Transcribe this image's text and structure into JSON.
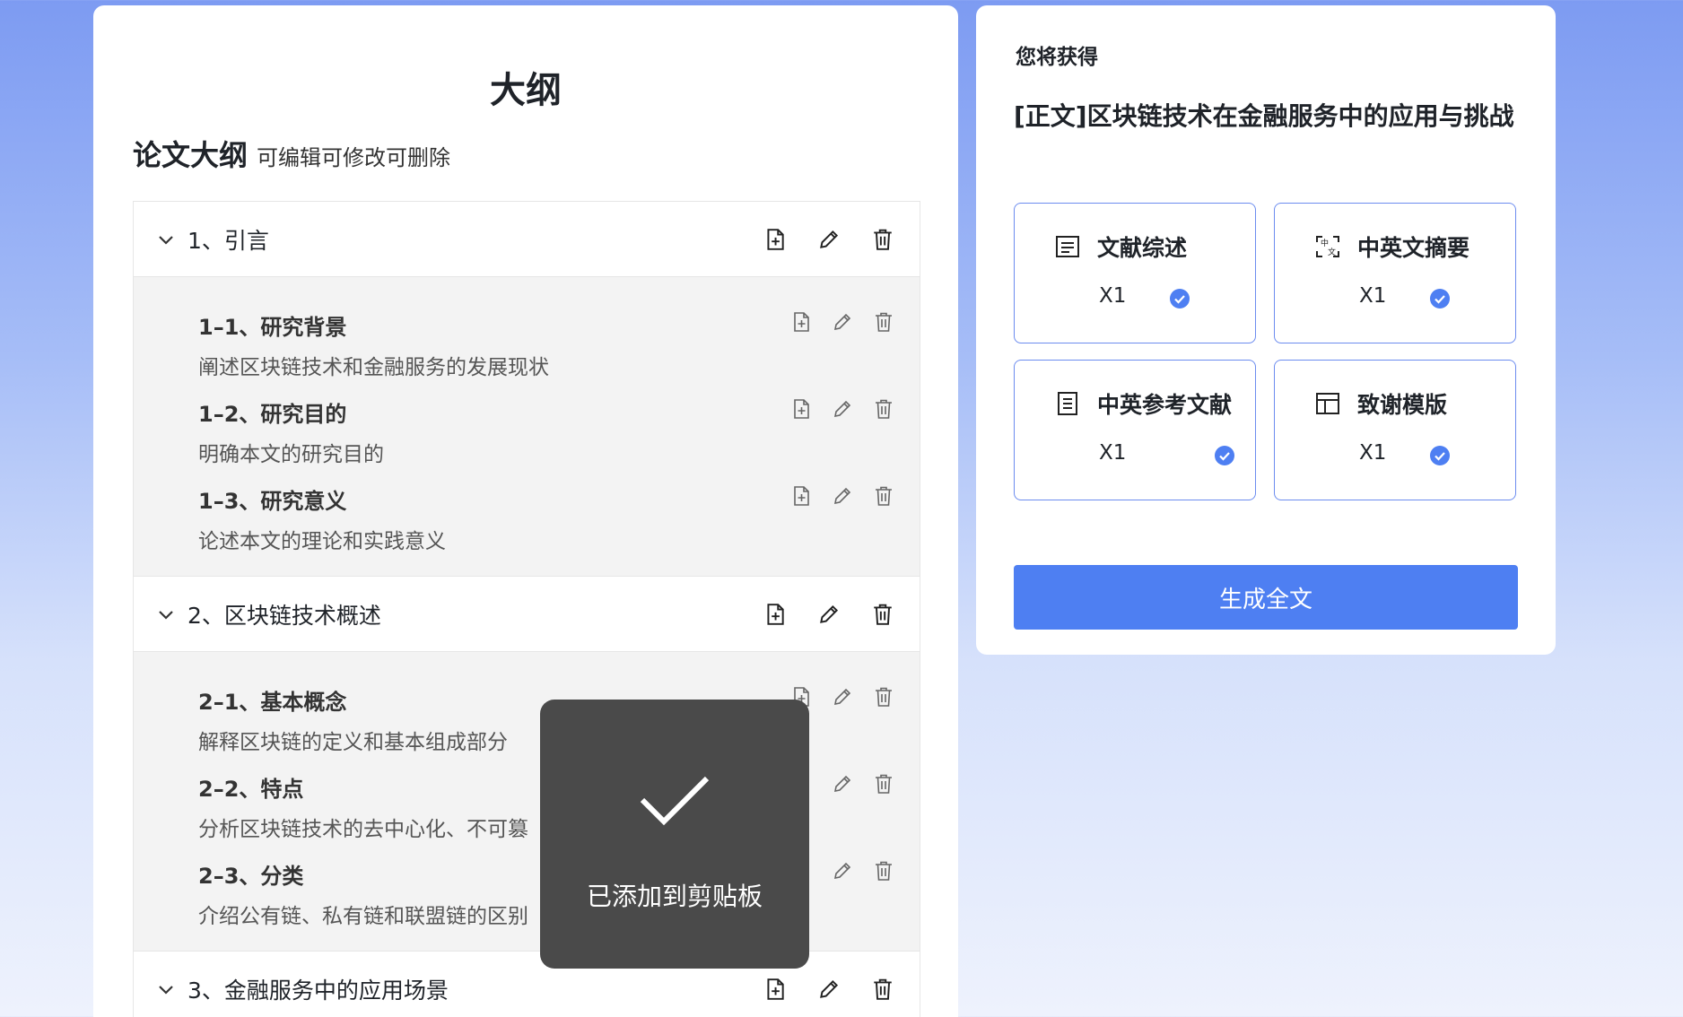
{
  "outline": {
    "title": "大纲",
    "subhead_main": "论文大纲",
    "subhead_hint": "可编辑可修改可删除",
    "sections": [
      {
        "title": "1、引言",
        "items": [
          {
            "title": "1–1、研究背景",
            "desc": "阐述区块链技术和金融服务的发展现状"
          },
          {
            "title": "1–2、研究目的",
            "desc": "明确本文的研究目的"
          },
          {
            "title": "1–3、研究意义",
            "desc": "论述本文的理论和实践意义"
          }
        ]
      },
      {
        "title": "2、区块链技术概述",
        "items": [
          {
            "title": "2–1、基本概念",
            "desc": "解释区块链的定义和基本组成部分"
          },
          {
            "title": "2–2、特点",
            "desc": "分析区块链技术的去中心化、不可篡"
          },
          {
            "title": "2–3、分类",
            "desc": "介绍公有链、私有链和联盟链的区别"
          }
        ]
      },
      {
        "title": "3、金融服务中的应用场景",
        "items": []
      }
    ]
  },
  "toast": {
    "message": "已添加到剪贴板",
    "icon": "check-icon"
  },
  "gain": {
    "label": "您将获得",
    "title": "[正文]区块链技术在金融服务中的应用与挑战",
    "tiles": [
      {
        "name": "文献综述",
        "qty": "X1",
        "icon": "document-lines-icon"
      },
      {
        "name": "中英文摘要",
        "qty": "X1",
        "icon": "translate-icon"
      },
      {
        "name": "中英参考文献",
        "qty": "X1",
        "icon": "list-document-icon"
      },
      {
        "name": "致谢模版",
        "qty": "X1",
        "icon": "layout-template-icon"
      }
    ],
    "button_label": "生成全文"
  },
  "colors": {
    "accent": "#4e7ff2",
    "tile_border": "#6c8cef",
    "toast_bg": "#4a4a4a",
    "sub_bg": "#f3f3f3"
  }
}
